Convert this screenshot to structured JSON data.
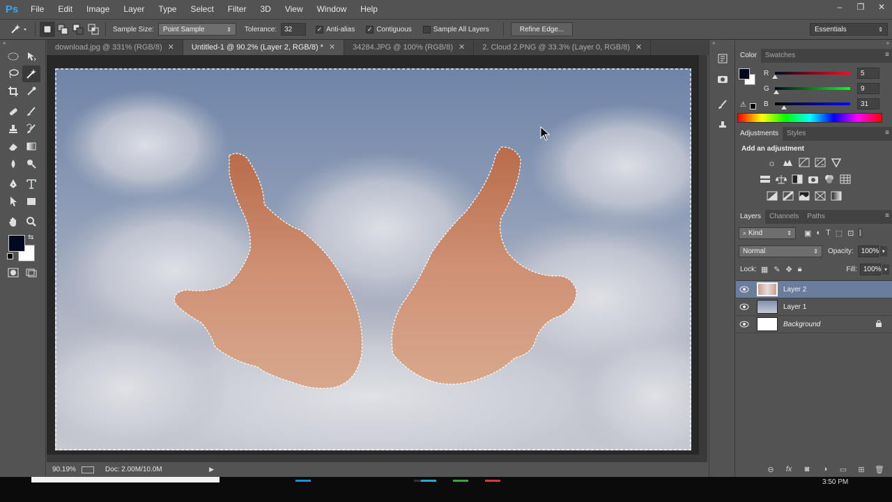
{
  "app": {
    "logo": "Ps"
  },
  "menu": [
    "File",
    "Edit",
    "Image",
    "Layer",
    "Type",
    "Select",
    "Filter",
    "3D",
    "View",
    "Window",
    "Help"
  ],
  "window_controls": [
    "–",
    "❐",
    "✕"
  ],
  "options": {
    "sample_size_label": "Sample Size:",
    "sample_size_value": "Point Sample",
    "tolerance_label": "Tolerance:",
    "tolerance_value": "32",
    "anti_alias_label": "Anti-alias",
    "anti_alias_checked": true,
    "contiguous_label": "Contiguous",
    "contiguous_checked": true,
    "sample_all_layers_label": "Sample All Layers",
    "sample_all_layers_checked": false,
    "refine_edge_label": "Refine Edge...",
    "workspace": "Essentials"
  },
  "tabs": [
    {
      "label": "download.jpg @ 331% (RGB/8)",
      "active": false
    },
    {
      "label": "Untitled-1 @ 90.2% (Layer 2, RGB/8) *",
      "active": true
    },
    {
      "label": "34284.JPG @ 100% (RGB/8)",
      "active": false
    },
    {
      "label": "2. Cloud 2.PNG @ 33.3% (Layer 0, RGB/8)",
      "active": false
    }
  ],
  "status": {
    "zoom": "90.19%",
    "doc": "Doc: 2.00M/10.0M"
  },
  "color_panel": {
    "tabs": [
      "Color",
      "Swatches"
    ],
    "r_label": "R",
    "r_value": "5",
    "g_label": "G",
    "g_value": "9",
    "b_label": "B",
    "b_value": "31",
    "foreground": "#05091f",
    "background": "#ffffff"
  },
  "adjustments_panel": {
    "tabs": [
      "Adjustments",
      "Styles"
    ],
    "title": "Add an adjustment"
  },
  "layers_panel": {
    "tabs": [
      "Layers",
      "Channels",
      "Paths"
    ],
    "kind_label": "Kind",
    "blend_mode": "Normal",
    "opacity_label": "Opacity:",
    "opacity_value": "100%",
    "lock_label": "Lock:",
    "fill_label": "Fill:",
    "fill_value": "100%",
    "layers": [
      {
        "name": "Layer 2",
        "selected": true
      },
      {
        "name": "Layer 1",
        "selected": false
      },
      {
        "name": "Background",
        "selected": false,
        "locked": true
      }
    ]
  },
  "taskbar": {
    "clock": "3:50 PM"
  },
  "icons": {
    "tools": [
      "marquee-icon",
      "move-icon",
      "lasso-icon",
      "magic-wand-icon",
      "crop-icon",
      "eyedropper-icon",
      "healing-brush-icon",
      "brush-icon",
      "clone-stamp-icon",
      "history-brush-icon",
      "eraser-icon",
      "gradient-icon",
      "blur-icon",
      "dodge-icon",
      "pen-icon",
      "type-icon",
      "path-selection-icon",
      "rectangle-icon",
      "hand-icon",
      "zoom-icon"
    ]
  }
}
